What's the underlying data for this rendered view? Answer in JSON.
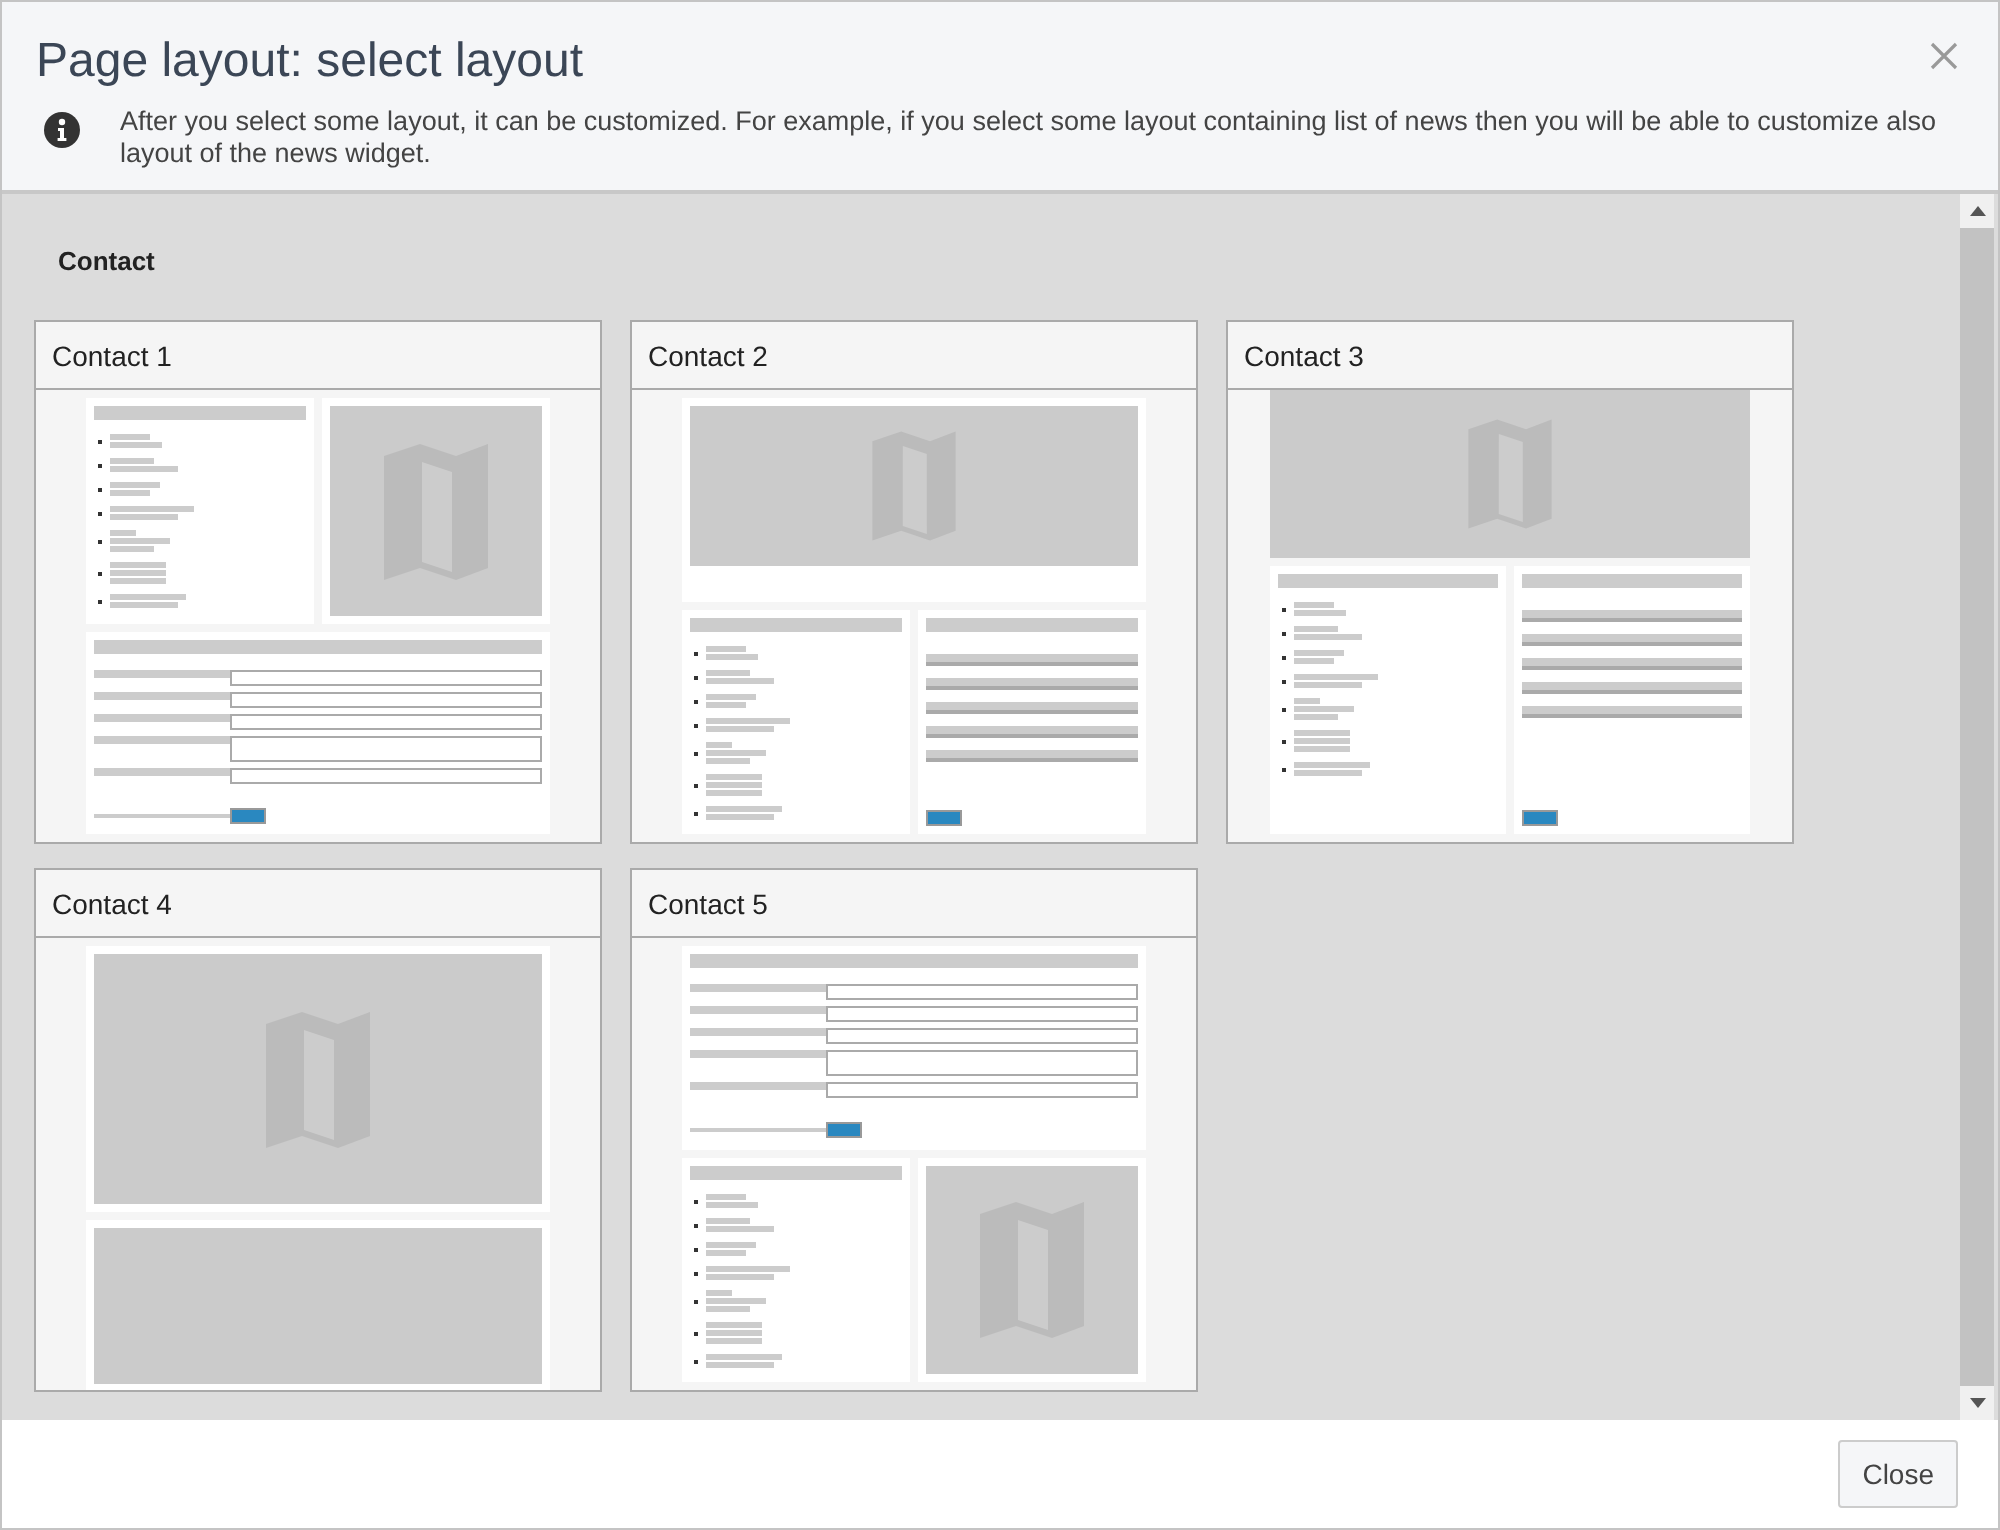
{
  "dialog": {
    "title": "Page layout: select layout",
    "info": "After you select some layout, it can be customized. For example, if you select some layout containing list of news then you will be able to customize also layout of the news widget."
  },
  "section": {
    "title": "Contact"
  },
  "layouts": [
    {
      "label": "Contact 1",
      "kind": "list-map-form"
    },
    {
      "label": "Contact 2",
      "kind": "map-list-form"
    },
    {
      "label": "Contact 3",
      "kind": "widemap-list-form"
    },
    {
      "label": "Contact 4",
      "kind": "map-block"
    },
    {
      "label": "Contact 5",
      "kind": "form-list-map"
    }
  ],
  "footer": {
    "buttons": [
      "Close"
    ]
  }
}
